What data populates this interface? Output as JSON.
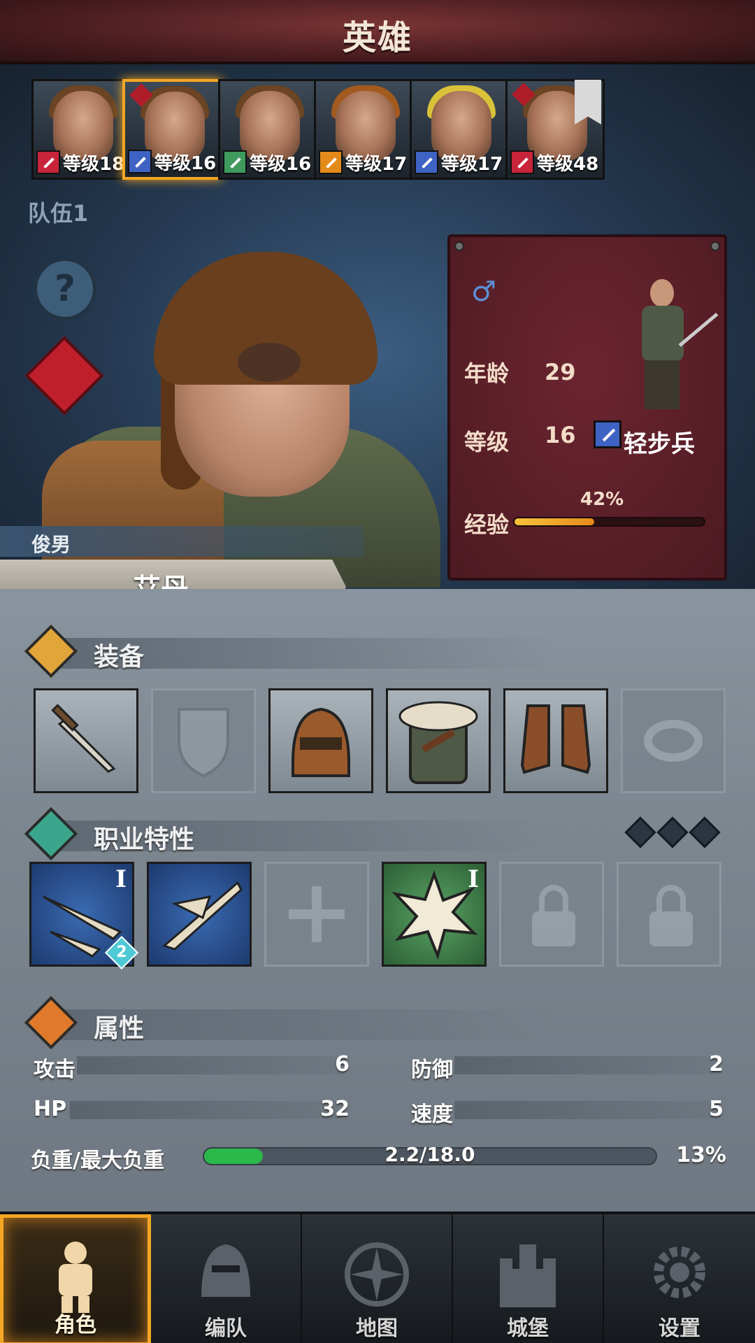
{
  "header": {
    "title": "英雄"
  },
  "heroes": [
    {
      "level": "等级18",
      "class_color": "red",
      "hair": "brown"
    },
    {
      "level": "等级16",
      "class_color": "blue",
      "hair": "brown",
      "selected": true
    },
    {
      "level": "等级16",
      "class_color": "green",
      "hair": "brown"
    },
    {
      "level": "等级17",
      "class_color": "orange",
      "hair": "orange"
    },
    {
      "level": "等级17",
      "class_color": "blue",
      "hair": "blond"
    },
    {
      "level": "等级48",
      "class_color": "red",
      "hair": "brown"
    }
  ],
  "team": {
    "label": "队伍1"
  },
  "character": {
    "nickname": "俊男",
    "name": "艾丹",
    "gender_symbol": "♂",
    "age_label": "年龄",
    "age": "29",
    "level_label": "等级",
    "level": "16",
    "class_name": "轻步兵",
    "xp_label": "经验",
    "xp_percent_text": "42%",
    "xp_fraction": 0.42
  },
  "sections": {
    "equipment": "装备",
    "traits": "职业特性",
    "attributes": "属性"
  },
  "equipment": [
    {
      "slot": "weapon",
      "icon": "dagger-icon",
      "filled": true
    },
    {
      "slot": "offhand",
      "icon": "shield-icon",
      "filled": false
    },
    {
      "slot": "head",
      "icon": "leather-hood-icon",
      "filled": true
    },
    {
      "slot": "body",
      "icon": "fur-coat-icon",
      "filled": true
    },
    {
      "slot": "legs",
      "icon": "boots-icon",
      "filled": true
    },
    {
      "slot": "ring",
      "icon": "ring-icon",
      "filled": false
    }
  ],
  "traits": [
    {
      "icon": "blades-icon",
      "color": "blue",
      "rank": "I",
      "stack": "2"
    },
    {
      "icon": "eagle-slash-icon",
      "color": "blue",
      "rank": "",
      "stack": ""
    },
    {
      "icon": "cross-icon",
      "color": "empty",
      "rank": "",
      "stack": ""
    },
    {
      "icon": "burst-icon",
      "color": "green",
      "rank": "I",
      "stack": ""
    },
    {
      "icon": "lock-icon",
      "color": "locked",
      "rank": "",
      "stack": ""
    },
    {
      "icon": "lock-icon",
      "color": "locked",
      "rank": "",
      "stack": ""
    }
  ],
  "attributes": {
    "attack_label": "攻击",
    "attack": "6",
    "defense_label": "防御",
    "defense": "2",
    "hp_label": "HP",
    "hp": "32",
    "speed_label": "速度",
    "speed": "5",
    "load_label": "负重/最大负重",
    "load_text": "2.2/18.0",
    "load_percent_text": "13%",
    "load_fraction": 0.13
  },
  "tabs": [
    {
      "label": "角色",
      "icon": "knight-icon",
      "active": true
    },
    {
      "label": "编队",
      "icon": "helmet-icon",
      "active": false
    },
    {
      "label": "地图",
      "icon": "compass-icon",
      "active": false
    },
    {
      "label": "城堡",
      "icon": "castle-icon",
      "active": false
    },
    {
      "label": "设置",
      "icon": "gear-icon",
      "active": false
    }
  ],
  "colors": {
    "accent": "#f5a623",
    "xp_bar": "#f8c23b",
    "load_bar": "#2bb84a",
    "panel_red": "#4d1a22"
  }
}
